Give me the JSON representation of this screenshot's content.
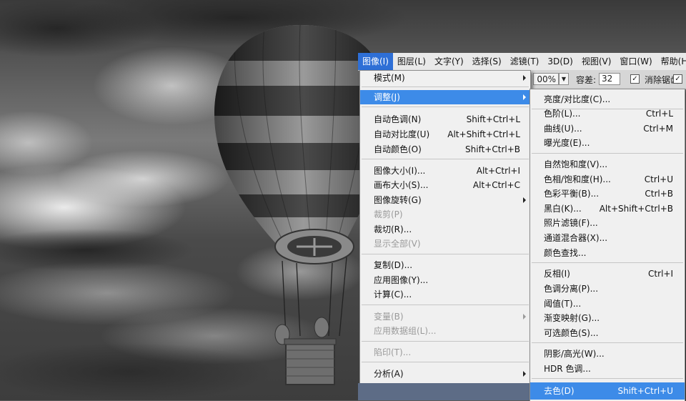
{
  "menubar": {
    "items": [
      "图像(I)",
      "图层(L)",
      "文字(Y)",
      "选择(S)",
      "滤镜(T)",
      "3D(D)",
      "视图(V)",
      "窗口(W)",
      "帮助(H"
    ],
    "active_index": 0
  },
  "options_bar": {
    "percent_value": "00%",
    "tolerance_label": "容差:",
    "tolerance_value": "32",
    "antialias_label": "消除锯齿",
    "antialias_checked": true,
    "check_glyph": "✓"
  },
  "image_menu": {
    "items": [
      {
        "label": "模式(M)",
        "shortcut": "",
        "submenu": true,
        "disabled": false
      },
      {
        "label": "调整(J)",
        "shortcut": "",
        "submenu": true,
        "disabled": false,
        "highlighted": true
      },
      {
        "label": "自动色调(N)",
        "shortcut": "Shift+Ctrl+L",
        "disabled": false
      },
      {
        "label": "自动对比度(U)",
        "shortcut": "Alt+Shift+Ctrl+L",
        "disabled": false
      },
      {
        "label": "自动颜色(O)",
        "shortcut": "Shift+Ctrl+B",
        "disabled": false
      },
      {
        "label": "图像大小(I)...",
        "shortcut": "Alt+Ctrl+I",
        "disabled": false
      },
      {
        "label": "画布大小(S)...",
        "shortcut": "Alt+Ctrl+C",
        "disabled": false
      },
      {
        "label": "图像旋转(G)",
        "shortcut": "",
        "submenu": true,
        "disabled": false
      },
      {
        "label": "裁剪(P)",
        "shortcut": "",
        "disabled": true
      },
      {
        "label": "裁切(R)...",
        "shortcut": "",
        "disabled": false
      },
      {
        "label": "显示全部(V)",
        "shortcut": "",
        "disabled": true
      },
      {
        "label": "复制(D)...",
        "shortcut": "",
        "disabled": false
      },
      {
        "label": "应用图像(Y)...",
        "shortcut": "",
        "disabled": false
      },
      {
        "label": "计算(C)...",
        "shortcut": "",
        "disabled": false
      },
      {
        "label": "变量(B)",
        "shortcut": "",
        "submenu": true,
        "disabled": true
      },
      {
        "label": "应用数据组(L)...",
        "shortcut": "",
        "disabled": true
      },
      {
        "label": "陷印(T)...",
        "shortcut": "",
        "disabled": true
      },
      {
        "label": "分析(A)",
        "shortcut": "",
        "submenu": true,
        "disabled": false
      }
    ]
  },
  "adjust_submenu": {
    "items": [
      {
        "label": "亮度/对比度(C)...",
        "shortcut": ""
      },
      {
        "label": "色阶(L)...",
        "shortcut": "Ctrl+L"
      },
      {
        "label": "曲线(U)...",
        "shortcut": "Ctrl+M"
      },
      {
        "label": "曝光度(E)...",
        "shortcut": ""
      },
      {
        "label": "自然饱和度(V)...",
        "shortcut": ""
      },
      {
        "label": "色相/饱和度(H)...",
        "shortcut": "Ctrl+U"
      },
      {
        "label": "色彩平衡(B)...",
        "shortcut": "Ctrl+B"
      },
      {
        "label": "黑白(K)...",
        "shortcut": "Alt+Shift+Ctrl+B"
      },
      {
        "label": "照片滤镜(F)...",
        "shortcut": ""
      },
      {
        "label": "通道混合器(X)...",
        "shortcut": ""
      },
      {
        "label": "颜色查找...",
        "shortcut": ""
      },
      {
        "label": "反相(I)",
        "shortcut": "Ctrl+I"
      },
      {
        "label": "色调分离(P)...",
        "shortcut": ""
      },
      {
        "label": "阈值(T)...",
        "shortcut": ""
      },
      {
        "label": "渐变映射(G)...",
        "shortcut": ""
      },
      {
        "label": "可选颜色(S)...",
        "shortcut": ""
      },
      {
        "label": "阴影/高光(W)...",
        "shortcut": ""
      },
      {
        "label": "HDR 色调...",
        "shortcut": ""
      },
      {
        "label": "去色(D)",
        "shortcut": "Shift+Ctrl+U",
        "highlighted": true
      }
    ]
  },
  "colors": {
    "highlight": "#3d8be8",
    "menubar_active": "#2e6fd6",
    "menu_bg": "#f0f0f0",
    "disabled_text": "#9a9a9a"
  }
}
